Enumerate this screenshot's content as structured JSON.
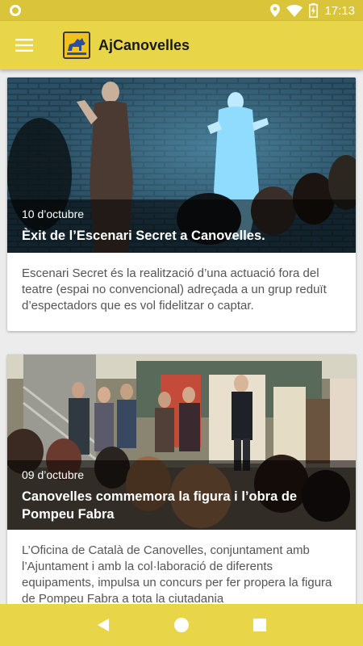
{
  "status_bar": {
    "time": "17:13",
    "icons": [
      "notification-circle-icon",
      "location-icon",
      "wifi-icon",
      "battery-charging-icon"
    ]
  },
  "app_bar": {
    "menu_icon": "hamburger-menu-icon",
    "logo_icon": "canovelles-logo-icon",
    "title": "AjCanovelles"
  },
  "news": [
    {
      "date": "10 d’octubre",
      "title": "Èxit de l’Escenari Secret a Canovelles.",
      "summary": "Escenari Secret és la  realització d’una actuació fora del teatre (espai no convencional) adreçada a un grup reduït d’espectadors que es vol fidelitzar o captar."
    },
    {
      "date": "09 d’octubre",
      "title": "Canovelles commemora la figura i l’obra de Pompeu Fabra",
      "summary": "L’Oficina de Català de Canovelles, conjuntament amb l’Ajuntament i amb la col·laboració de diferents equipaments, impulsa un concurs per fer propera la figura de Pompeu Fabra a tota la ciutadania"
    }
  ],
  "nav_bar": {
    "back_icon": "back-triangle-icon",
    "home_icon": "home-circle-icon",
    "recents_icon": "recents-square-icon"
  },
  "colors": {
    "status_bar": "#d9c43a",
    "app_bar": "#e8d648",
    "nav_bar": "#e8d648"
  }
}
